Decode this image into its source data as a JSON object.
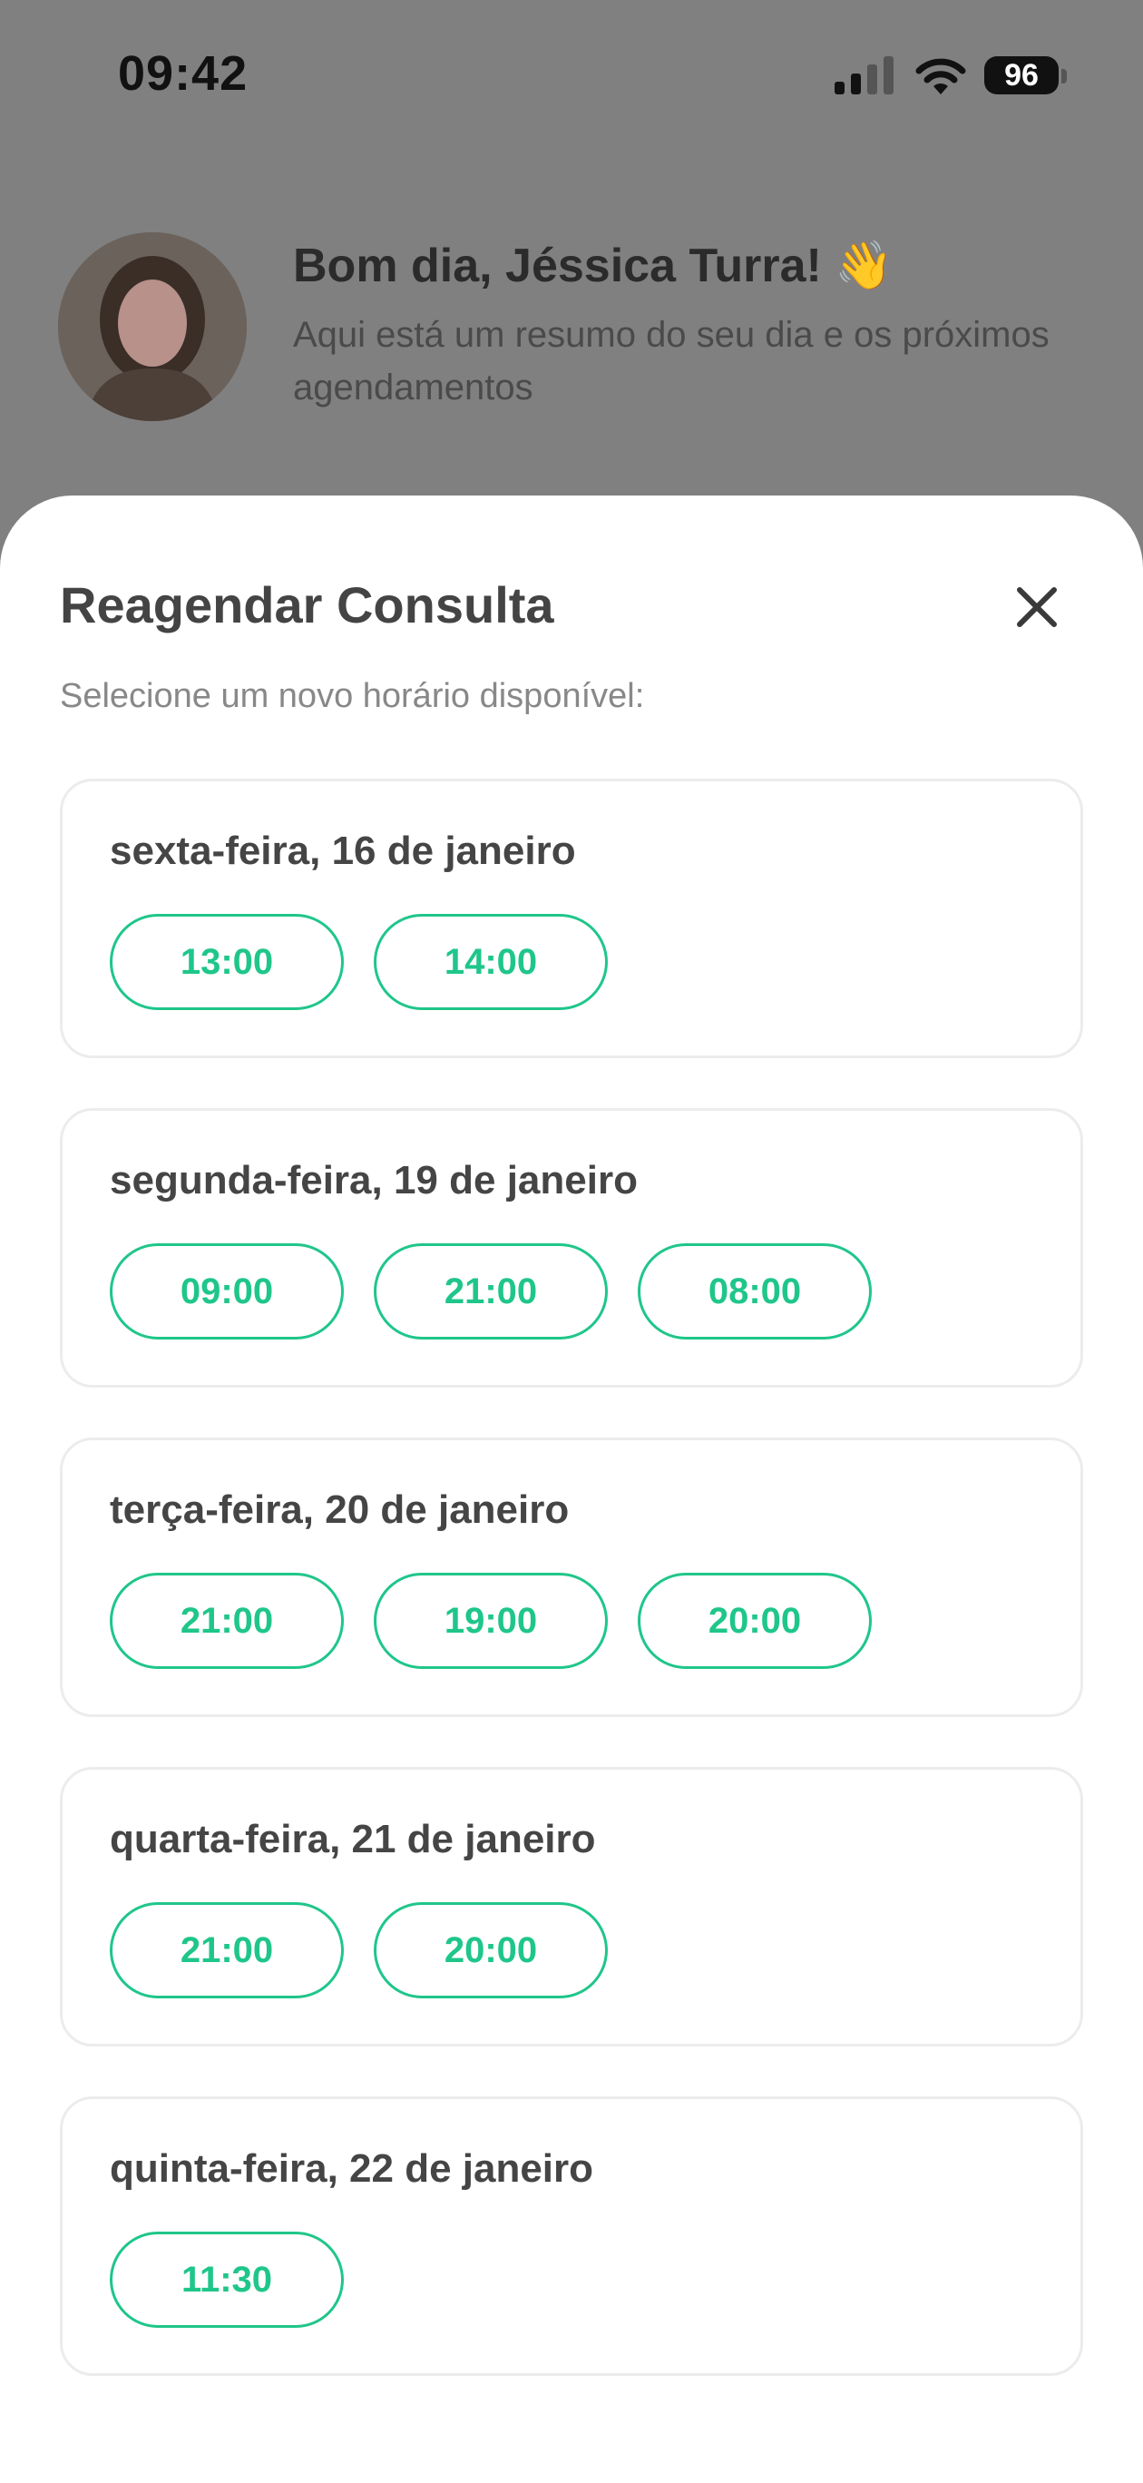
{
  "status_bar": {
    "time": "09:42",
    "battery": "96"
  },
  "header": {
    "greeting": "Bom dia, Jéssica Turra! 👋",
    "subtitle": "Aqui está um resumo do seu dia e os próximos agendamentos"
  },
  "sheet": {
    "title": "Reagendar Consulta",
    "subtitle": "Selecione um novo horário disponível:",
    "days": [
      {
        "label": "sexta-feira, 16 de janeiro",
        "slots": [
          "13:00",
          "14:00"
        ]
      },
      {
        "label": "segunda-feira, 19 de janeiro",
        "slots": [
          "09:00",
          "21:00",
          "08:00"
        ]
      },
      {
        "label": "terça-feira, 20 de janeiro",
        "slots": [
          "21:00",
          "19:00",
          "20:00"
        ]
      },
      {
        "label": "quarta-feira, 21 de janeiro",
        "slots": [
          "21:00",
          "20:00"
        ]
      },
      {
        "label": "quinta-feira, 22 de janeiro",
        "slots": [
          "11:30"
        ]
      }
    ]
  },
  "colors": {
    "accent": "#1fc68a",
    "overlay": "#808080",
    "sheet_bg": "#ffffff"
  },
  "icons": {
    "close": "close-icon",
    "signal": "cellular-signal-icon",
    "wifi": "wifi-icon",
    "battery": "battery-icon"
  }
}
